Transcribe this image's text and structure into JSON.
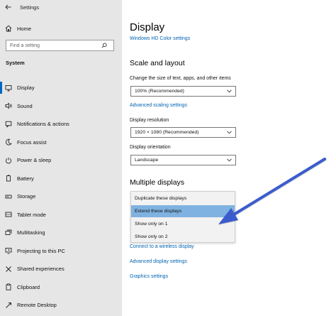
{
  "window": {
    "title": "Settings"
  },
  "sidebar": {
    "home_label": "Home",
    "search_placeholder": "Find a setting",
    "section": "System",
    "items": [
      {
        "label": "Display",
        "icon": "monitor-icon",
        "active": true
      },
      {
        "label": "Sound",
        "icon": "speaker-icon"
      },
      {
        "label": "Notifications & actions",
        "icon": "notification-icon"
      },
      {
        "label": "Focus assist",
        "icon": "moon-icon"
      },
      {
        "label": "Power & sleep",
        "icon": "power-icon"
      },
      {
        "label": "Battery",
        "icon": "battery-icon"
      },
      {
        "label": "Storage",
        "icon": "storage-icon"
      },
      {
        "label": "Tablet mode",
        "icon": "tablet-icon"
      },
      {
        "label": "Multitasking",
        "icon": "multitasking-icon"
      },
      {
        "label": "Projecting to this PC",
        "icon": "projector-icon"
      },
      {
        "label": "Shared experiences",
        "icon": "shared-icon"
      },
      {
        "label": "Clipboard",
        "icon": "clipboard-icon"
      },
      {
        "label": "Remote Desktop",
        "icon": "remote-desktop-icon"
      }
    ]
  },
  "main": {
    "title": "Display",
    "hd_color_link": "Windows HD Color settings",
    "scale_heading": "Scale and layout",
    "scale_label": "Change the size of text, apps, and other items",
    "scale_value": "100% (Recommended)",
    "advanced_scaling_link": "Advanced scaling settings",
    "resolution_label": "Display resolution",
    "resolution_value": "1920 × 1080 (Recommended)",
    "orientation_label": "Display orientation",
    "orientation_value": "Landscape",
    "multiple_heading": "Multiple displays",
    "multiple_options": [
      {
        "label": "Duplicate these displays",
        "selected": false
      },
      {
        "label": "Extend these displays",
        "selected": true
      },
      {
        "label": "Show only on 1",
        "selected": false
      },
      {
        "label": "Show only on 2",
        "selected": false
      }
    ],
    "wireless_link": "Connect to a wireless display",
    "advanced_display_link": "Advanced display settings",
    "graphics_link": "Graphics settings"
  },
  "colors": {
    "accent": "#0067c0",
    "link": "#0063b1",
    "selection": "#7fb2e0",
    "annotation_arrow": "#3a5ccc"
  }
}
